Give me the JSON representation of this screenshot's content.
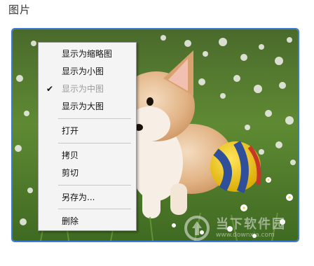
{
  "section": {
    "title": "图片"
  },
  "image": {
    "subject": "corgi puppy with a toy ball on grass",
    "border_color": "#3c7bdc"
  },
  "context_menu": {
    "items": [
      {
        "label": "显示为缩略图",
        "checked": false,
        "disabled": false
      },
      {
        "label": "显示为小图",
        "checked": false,
        "disabled": false
      },
      {
        "label": "显示为中图",
        "checked": true,
        "disabled": true
      },
      {
        "label": "显示为大图",
        "checked": false,
        "disabled": false
      },
      {
        "label": "打开",
        "checked": false,
        "disabled": false
      },
      {
        "label": "拷贝",
        "checked": false,
        "disabled": false
      },
      {
        "label": "剪切",
        "checked": false,
        "disabled": false
      },
      {
        "label": "另存为...",
        "checked": false,
        "disabled": false
      },
      {
        "label": "删除",
        "checked": false,
        "disabled": false
      }
    ],
    "check_mark": "✔"
  },
  "watermark": {
    "title": "当下软件园",
    "url": "www.downxia.com"
  }
}
